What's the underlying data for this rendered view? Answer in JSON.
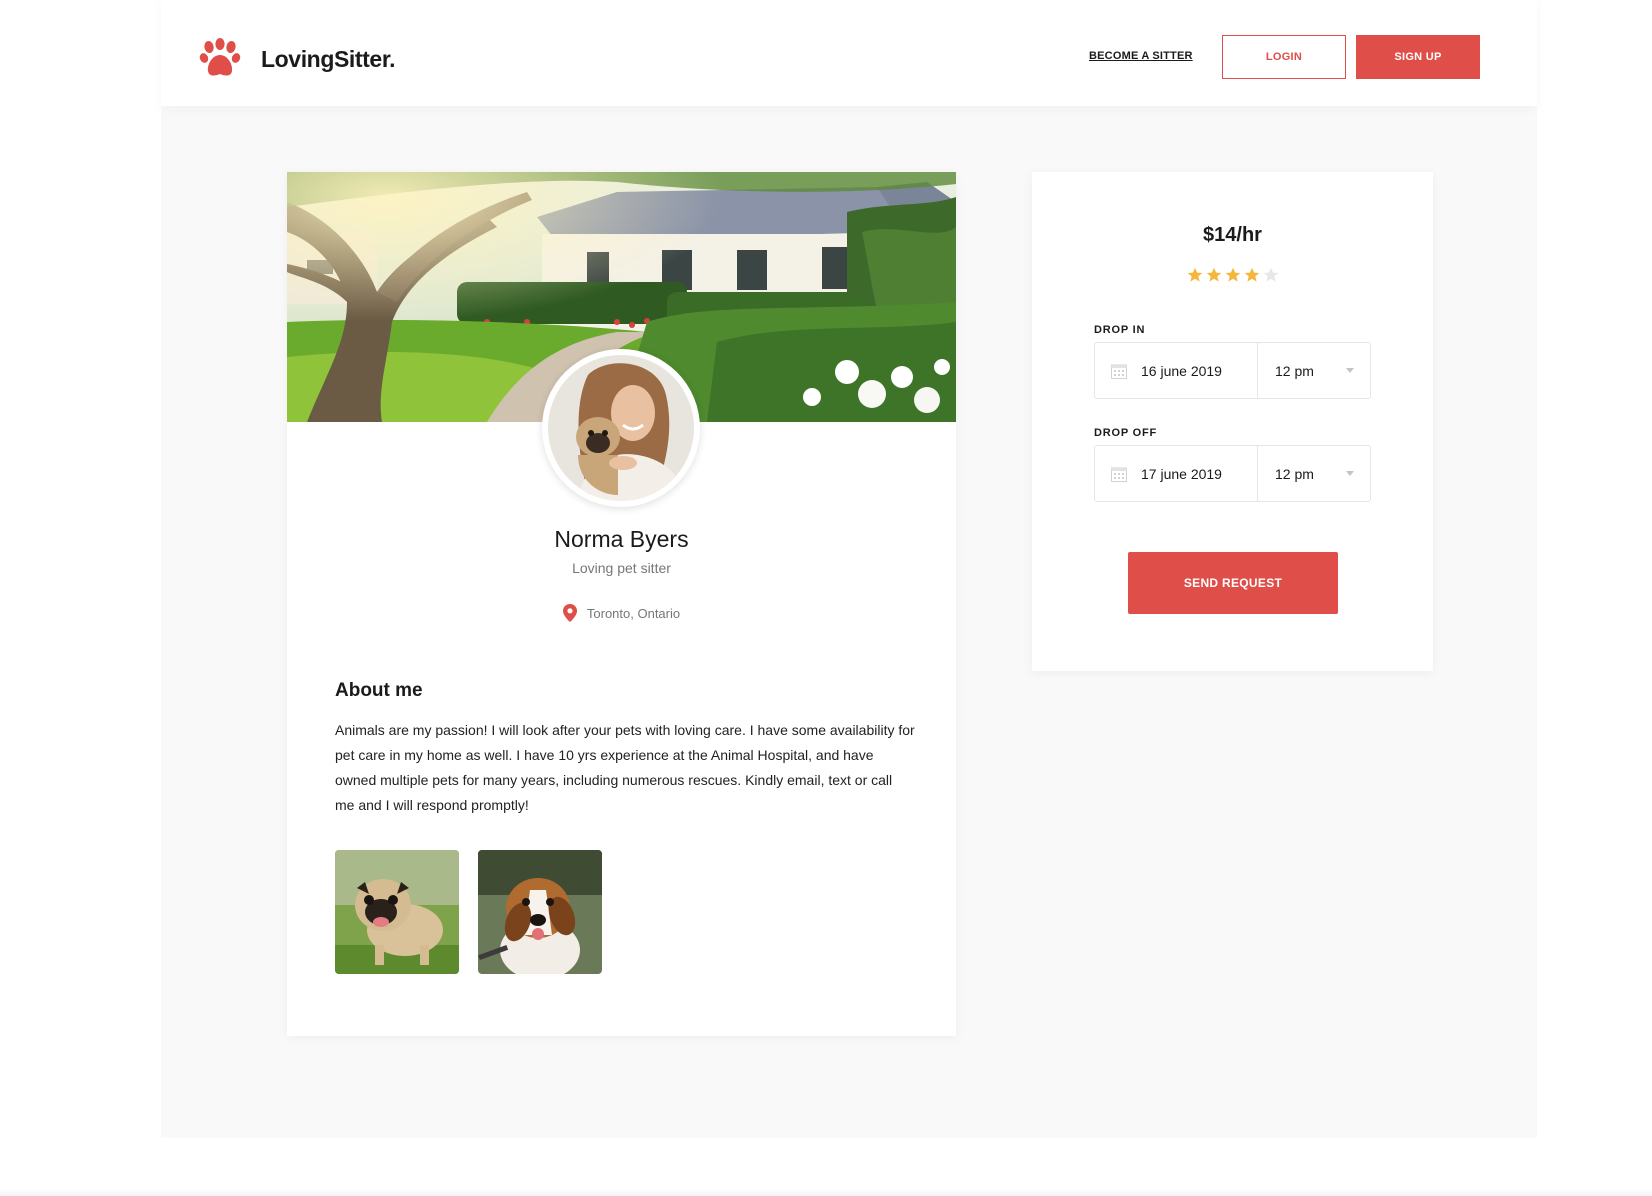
{
  "brand": {
    "name": "LovingSitter.",
    "logo_icon": "paw-icon",
    "accent_color": "#df4e48"
  },
  "nav": {
    "become_sitter": "BECOME A SITTER",
    "login": "LOGIN",
    "signup": "SIGN UP"
  },
  "profile": {
    "name": "Norma Byers",
    "role": "Loving pet sitter",
    "location": "Toronto, Ontario",
    "location_icon": "map-pin-icon",
    "about_title": "About me",
    "about_text": "Animals are my passion! I will look after your pets with loving care. I have some availability for pet care in my home as well. I have 10 yrs experience at the Animal Hospital, and have owned multiple pets for many years, including numerous rescues. Kindly email, text or call me and I will respond promptly!",
    "photos": [
      "pug-photo",
      "beagle-photo"
    ]
  },
  "booking": {
    "price": "$14/hr",
    "rating": 4,
    "rating_max": 5,
    "drop_in": {
      "label": "DROP IN",
      "date": "16 june 2019",
      "time": "12 pm"
    },
    "drop_off": {
      "label": "DROP OFF",
      "date": "17 june 2019",
      "time": "12 pm"
    },
    "send_label": "SEND REQUEST"
  }
}
